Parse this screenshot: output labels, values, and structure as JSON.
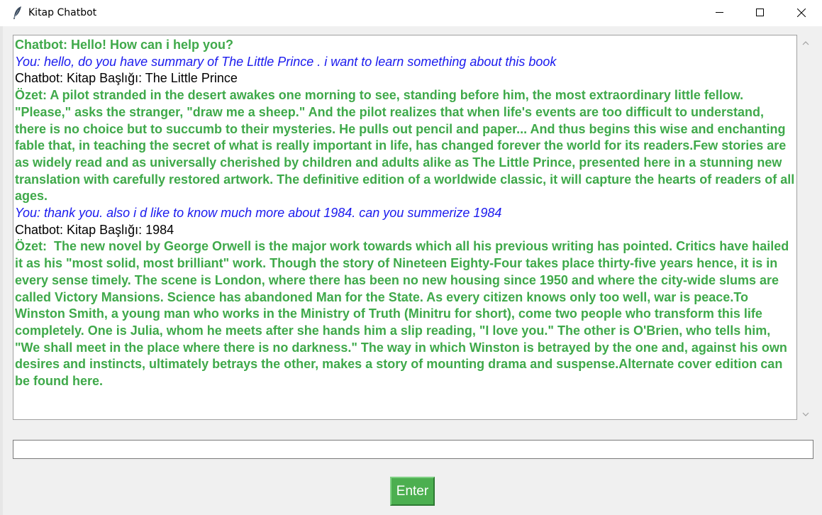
{
  "window": {
    "title": "Kitap Chatbot",
    "icon": "feather-icon"
  },
  "chat": {
    "messages": [
      {
        "type": "bot-green",
        "text": "Chatbot: Hello! How can i help you?"
      },
      {
        "type": "user",
        "text": "You: hello, do you have summary of The Little Prince . i want to learn something about this book"
      },
      {
        "type": "bot-plain",
        "text": "Chatbot: Kitap Başlığı: The Little Prince"
      },
      {
        "type": "bot-green",
        "text": "Özet: A pilot stranded in the desert awakes one morning to see, standing before him, the most extraordinary little fellow. \"Please,\" asks the stranger, \"draw me a sheep.\" And the pilot realizes that when life's events are too difficult to understand, there is no choice but to succumb to their mysteries. He pulls out pencil and paper... And thus begins this wise and enchanting fable that, in teaching the secret of what is really important in life, has changed forever the world for its readers.Few stories are as widely read and as universally cherished by children and adults alike as The Little Prince, presented here in a stunning new translation with carefully restored artwork. The definitive edition of a worldwide classic, it will capture the hearts of readers of all ages."
      },
      {
        "type": "user",
        "text": "You: thank you. also i d like to know much more about 1984. can you summerize 1984"
      },
      {
        "type": "bot-plain",
        "text": "Chatbot: Kitap Başlığı: 1984"
      },
      {
        "type": "bot-green",
        "text": "Özet:  The new novel by George Orwell is the major work towards which all his previous writing has pointed. Critics have hailed it as his \"most solid, most brilliant\" work. Though the story of Nineteen Eighty-Four takes place thirty-five years hence, it is in every sense timely. The scene is London, where there has been no new housing since 1950 and where the city-wide slums are called Victory Mansions. Science has abandoned Man for the State. As every citizen knows only too well, war is peace.To Winston Smith, a young man who works in the Ministry of Truth (Minitru for short), come two people who transform this life completely. One is Julia, whom he meets after she hands him a slip reading, \"I love you.\" The other is O'Brien, who tells him, \"We shall meet in the place where there is no darkness.\" The way in which Winston is betrayed by the one and, against his own desires and instincts, ultimately betrays the other, makes a story of mounting drama and suspense.Alternate cover edition can be found here."
      }
    ]
  },
  "input": {
    "value": "",
    "placeholder": ""
  },
  "enter_button": {
    "label": "Enter"
  },
  "colors": {
    "bot_green": "#3fa94a",
    "user_blue": "#1a1aee",
    "button_green": "#4caf50"
  }
}
